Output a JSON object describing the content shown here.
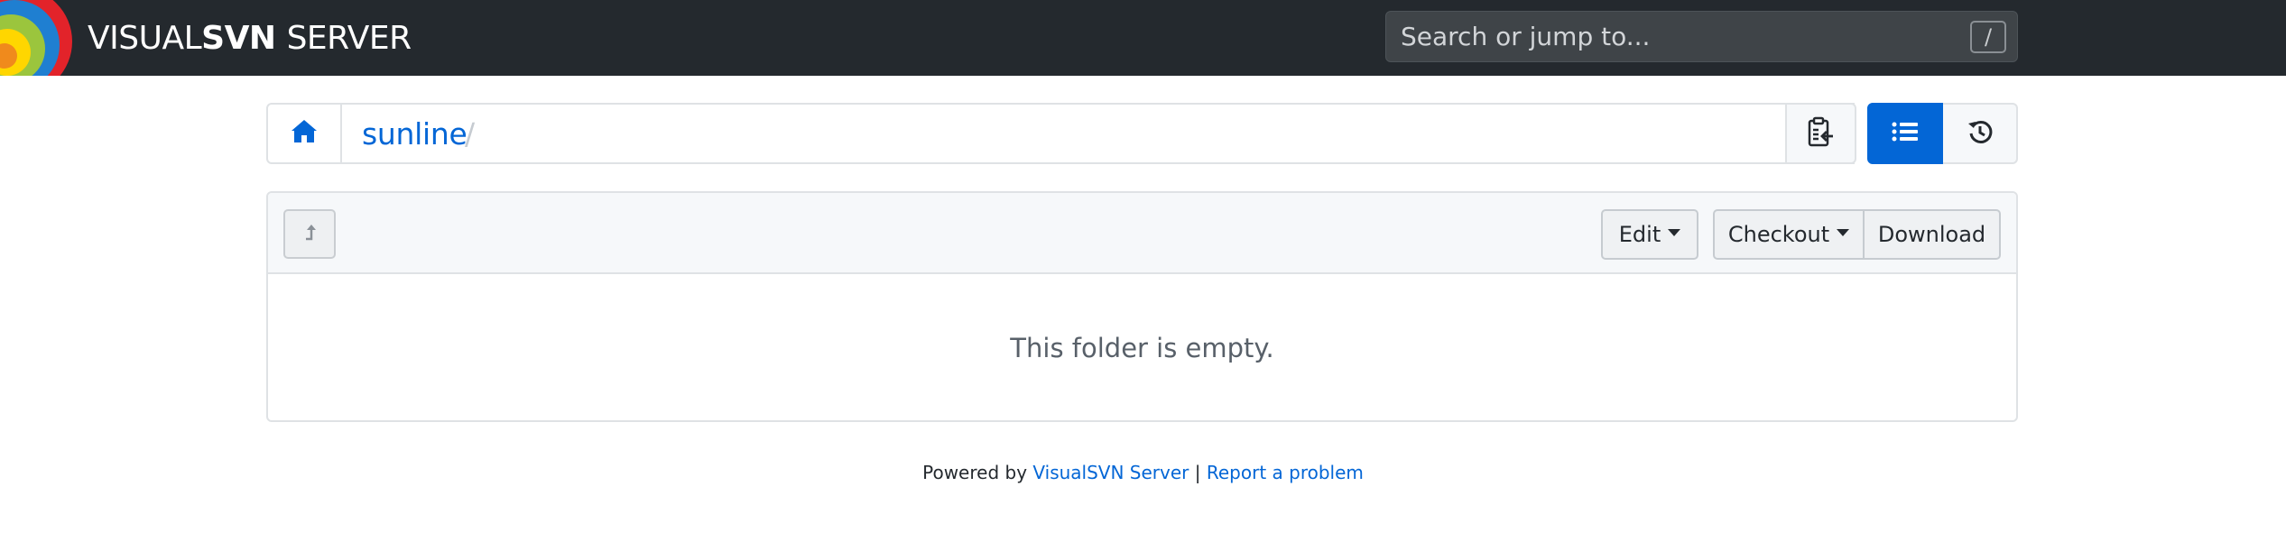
{
  "app": {
    "brand_prefix": "VISUAL",
    "brand_bold": "SVN",
    "brand_suffix": "SERVER",
    "logo_icon": "visualsvn-logo-icon"
  },
  "search": {
    "placeholder": "Search or jump to...",
    "value": "",
    "shortcut": "/"
  },
  "breadcrumb": {
    "home_icon": "home-icon",
    "repository": "sunline",
    "separator": "/",
    "copy_icon": "clipboard-copy-icon"
  },
  "view_toggle": {
    "list_icon": "list-icon",
    "history_icon": "history-icon",
    "active": "list"
  },
  "toolbar": {
    "up_icon": "level-up-icon",
    "edit_label": "Edit",
    "checkout_label": "Checkout",
    "download_label": "Download"
  },
  "content": {
    "empty_message": "This folder is empty."
  },
  "footer": {
    "powered_by": "Powered by",
    "product_link": "VisualSVN Server",
    "separator": "|",
    "report_link": "Report a problem"
  },
  "colors": {
    "navbar_bg": "#24292e",
    "accent": "#0366d6",
    "border": "#dfe2e5",
    "toolbar_bg": "#f6f8fa"
  }
}
